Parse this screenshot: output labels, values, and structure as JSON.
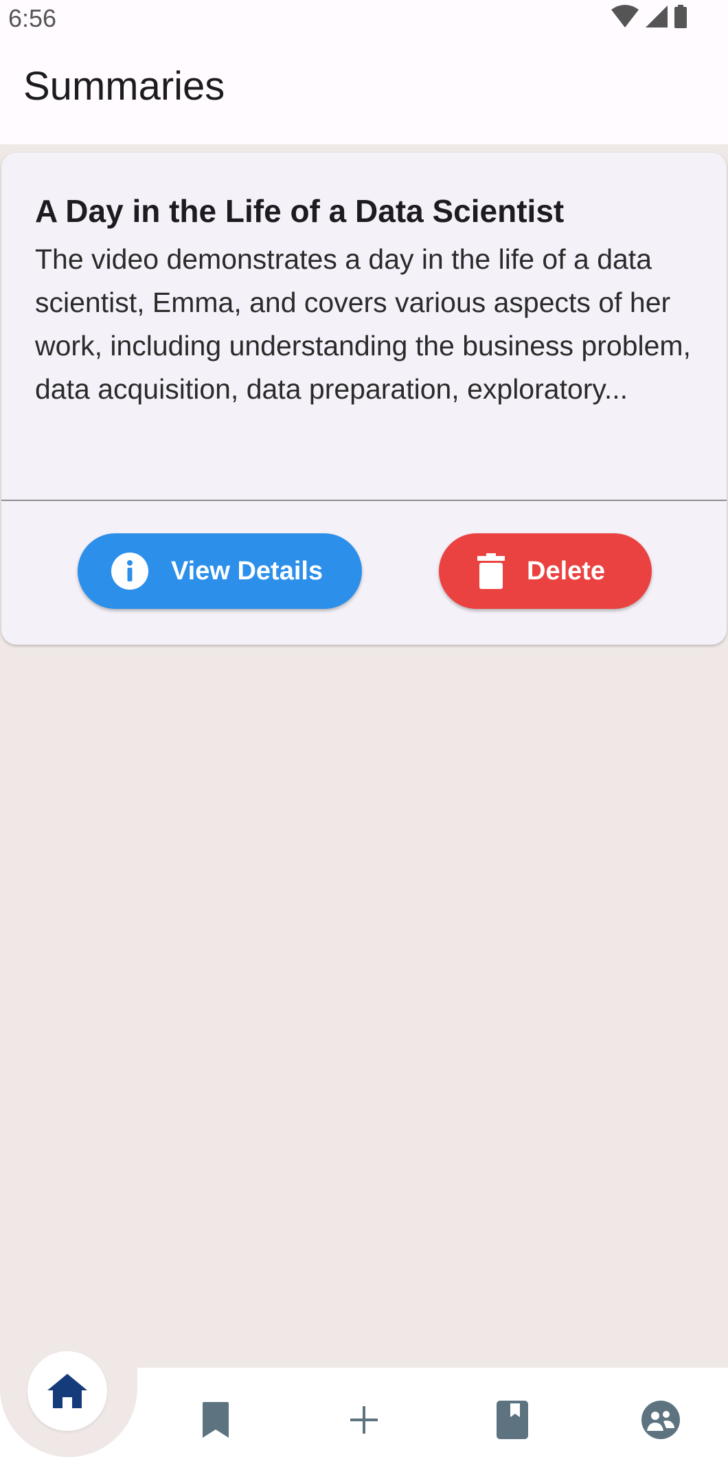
{
  "status_bar": {
    "time": "6:56",
    "icons": [
      "wifi-icon",
      "signal-icon",
      "battery-icon"
    ]
  },
  "app_bar": {
    "title": "Summaries"
  },
  "summaries": [
    {
      "title": "A Day in the Life of a Data Scientist",
      "description": "The video demonstrates a day in the life of a data scientist, Emma, and covers various aspects of her work, including understanding the business problem, data acquisition, data preparation, exploratory...",
      "view_label": "View Details",
      "delete_label": "Delete"
    }
  ],
  "bottom_nav": {
    "items": [
      "home-icon",
      "bookmark-icon",
      "plus-icon",
      "book-icon",
      "community-icon"
    ],
    "active": "home-icon"
  },
  "colors": {
    "view_button": "#2c8fea",
    "delete_button": "#ea4240",
    "nav_active": "#163b7a",
    "nav_inactive": "#5d7380",
    "background": "#efe8e6"
  }
}
